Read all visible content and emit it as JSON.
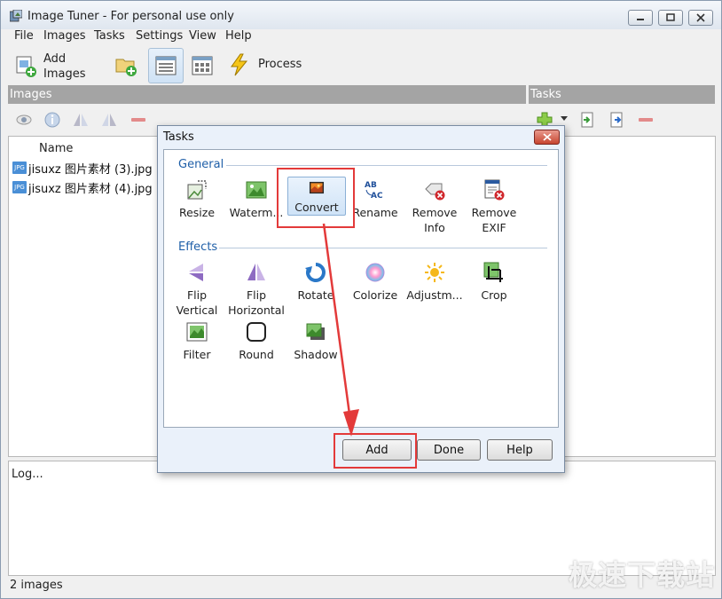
{
  "window": {
    "title": "Image Tuner - For personal use only"
  },
  "menu": [
    "File",
    "Images",
    "Tasks",
    "Settings",
    "View",
    "Help"
  ],
  "toolbar": {
    "add_images_line1": "Add",
    "add_images_line2": "Images",
    "process_label": "Process"
  },
  "panels": {
    "images_header": "Images",
    "tasks_header": "Tasks"
  },
  "image_list": {
    "column_name": "Name",
    "files": [
      "jisuxz 图片素材 (3).jpg",
      "jisuxz 图片素材 (4).jpg"
    ],
    "file_badge": "JPG"
  },
  "log": {
    "text": "Log..."
  },
  "status": {
    "text": "2 images"
  },
  "watermark": "极速下载站",
  "dialog": {
    "title": "Tasks",
    "general_label": "General",
    "effects_label": "Effects",
    "general_tasks": [
      {
        "l1": "Resize",
        "l2": ""
      },
      {
        "l1": "Waterm...",
        "l2": ""
      },
      {
        "l1": "Convert",
        "l2": ""
      },
      {
        "l1": "Rename",
        "l2": ""
      },
      {
        "l1": "Remove",
        "l2": "Info"
      },
      {
        "l1": "Remove",
        "l2": "EXIF"
      }
    ],
    "effects_tasks": [
      {
        "l1": "Flip",
        "l2": "Vertical"
      },
      {
        "l1": "Flip",
        "l2": "Horizontal"
      },
      {
        "l1": "Rotate",
        "l2": ""
      },
      {
        "l1": "Colorize",
        "l2": ""
      },
      {
        "l1": "Adjustm...",
        "l2": ""
      },
      {
        "l1": "Crop",
        "l2": ""
      },
      {
        "l1": "Filter",
        "l2": ""
      },
      {
        "l1": "Round",
        "l2": ""
      },
      {
        "l1": "Shadow",
        "l2": ""
      }
    ],
    "rename_icon_text": "AB AC",
    "buttons": {
      "add": "Add",
      "done": "Done",
      "help": "Help"
    }
  },
  "colors": {
    "annotation_red": "#e33a3a",
    "group_blue": "#1f5fa8",
    "panel_header": "#a4a4a4"
  }
}
